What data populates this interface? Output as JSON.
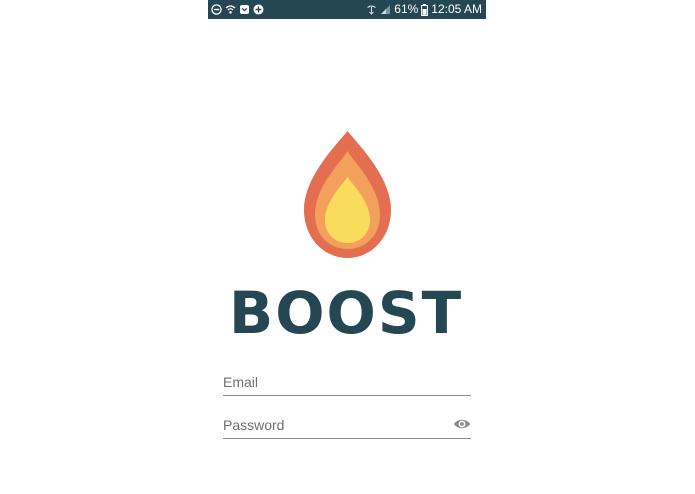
{
  "status_bar": {
    "battery_percent": "61%",
    "time": "12:05 AM",
    "left_icons": [
      "do-not-disturb-icon",
      "wifi-icon",
      "pocket-icon",
      "add-circle-icon"
    ],
    "right_icons": [
      "wifi-calling-icon",
      "signal-icon",
      "battery-icon"
    ],
    "background_color": "#254653"
  },
  "logo": {
    "brand_name": "BOOST",
    "icon": "flame-icon",
    "colors": {
      "outer": "#E46E50",
      "middle": "#F2A05C",
      "inner": "#F9DC5C",
      "text": "#254653"
    }
  },
  "login_form": {
    "email": {
      "placeholder": "Email",
      "value": ""
    },
    "password": {
      "placeholder": "Password",
      "value": "",
      "toggle_icon": "eye-icon"
    }
  }
}
